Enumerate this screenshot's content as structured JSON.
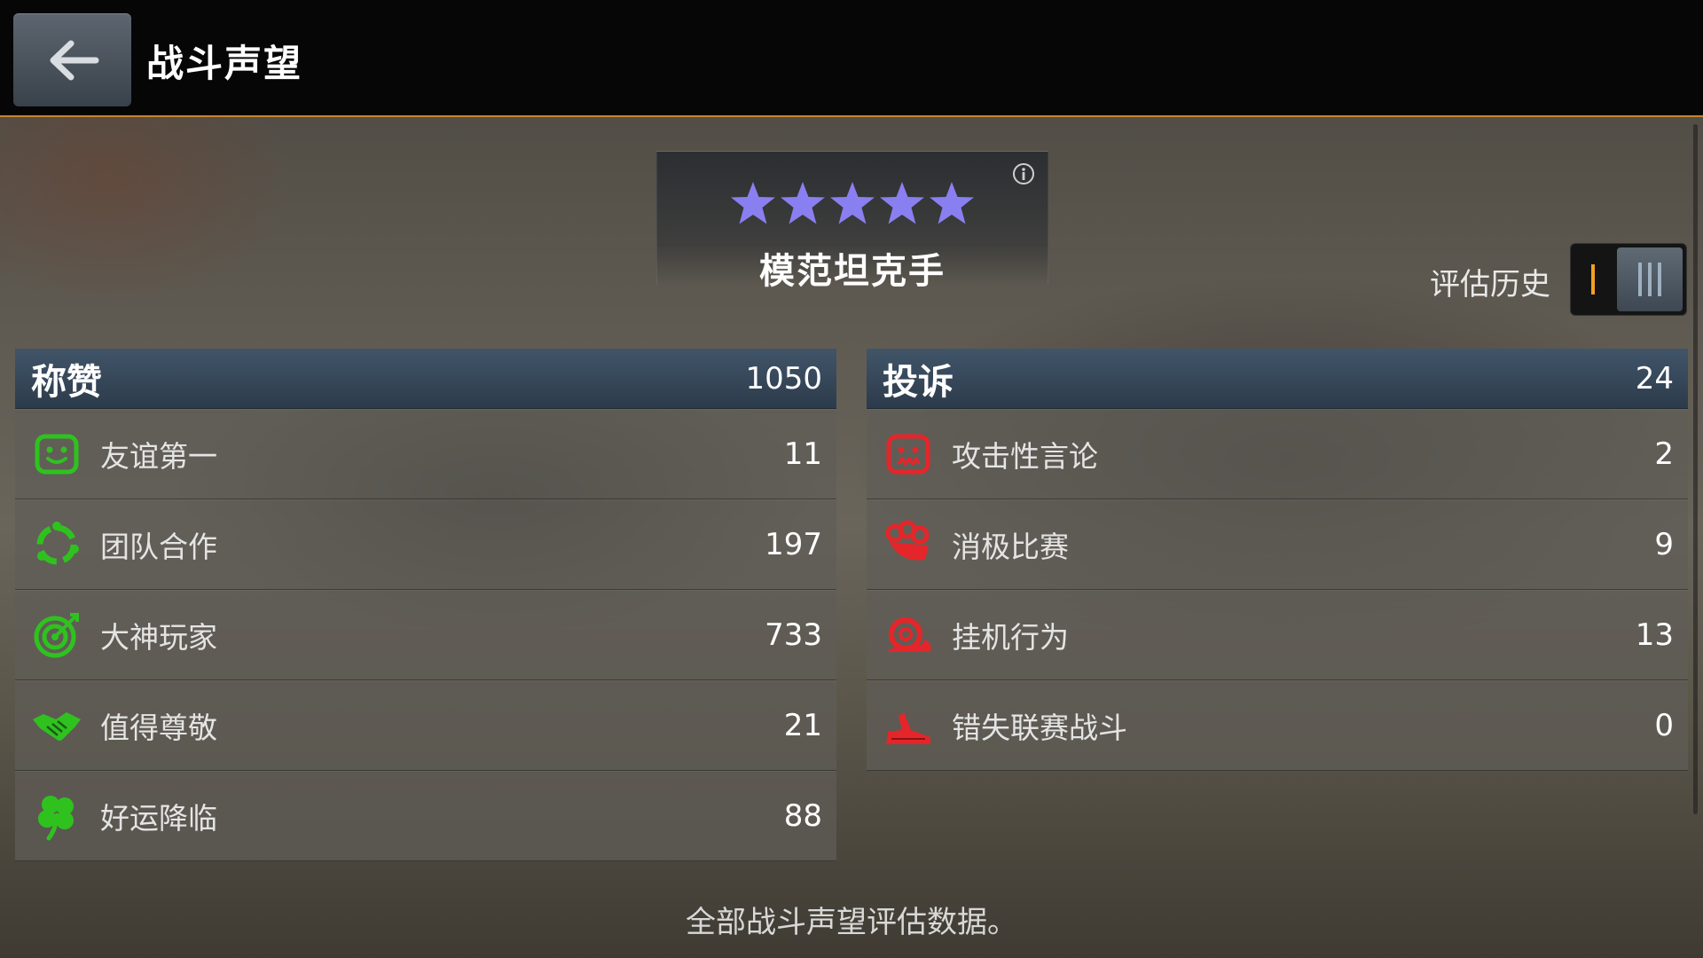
{
  "header": {
    "title": "战斗声望",
    "back_icon": "back-arrow-icon"
  },
  "rating": {
    "stars": 5,
    "star_color": "#8a7ff0",
    "title": "模范坦克手",
    "info_icon": "info-icon"
  },
  "history": {
    "label": "评估历史"
  },
  "praise": {
    "title": "称赞",
    "total": "1050",
    "accent": "#2fc21f",
    "items": [
      {
        "icon": "smiley-icon",
        "label": "友谊第一",
        "count": "11"
      },
      {
        "icon": "teamwork-ring-icon",
        "label": "团队合作",
        "count": "197"
      },
      {
        "icon": "target-icon",
        "label": "大神玩家",
        "count": "733"
      },
      {
        "icon": "handshake-icon",
        "label": "值得尊敬",
        "count": "21"
      },
      {
        "icon": "clover-icon",
        "label": "好运降临",
        "count": "88"
      }
    ]
  },
  "complaints": {
    "title": "投诉",
    "total": "24",
    "accent": "#e4262a",
    "items": [
      {
        "icon": "angry-face-icon",
        "label": "攻击性言论",
        "count": "2"
      },
      {
        "icon": "brass-knuckles-icon",
        "label": "消极比赛",
        "count": "9"
      },
      {
        "icon": "snail-icon",
        "label": "挂机行为",
        "count": "13"
      },
      {
        "icon": "missed-battle-icon",
        "label": "错失联赛战斗",
        "count": "0"
      }
    ]
  },
  "footer": {
    "note": "全部战斗声望评估数据。"
  }
}
